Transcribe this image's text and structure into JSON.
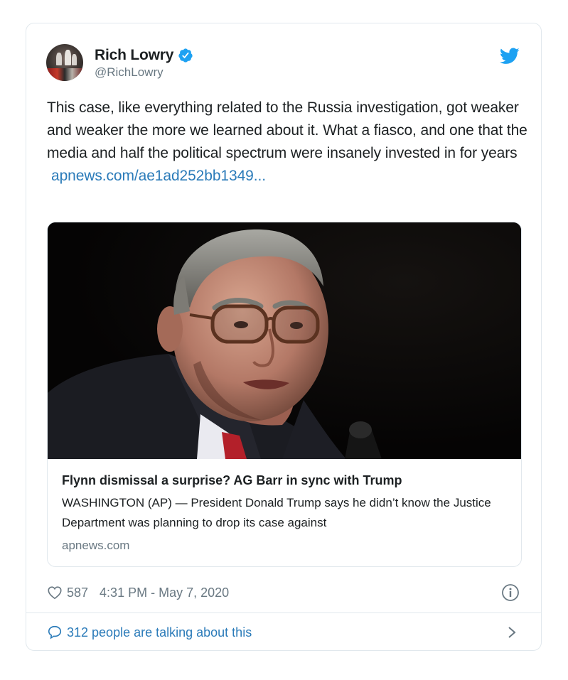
{
  "author": {
    "display_name": "Rich Lowry",
    "handle": "@RichLowry"
  },
  "tweet": {
    "text": "This case, like everything related to the Russia investigation, got weaker and weaker the more we learned about it. What a fiasco, and one that the media and half the political spectrum were insanely invested in for years",
    "link_text": "apnews.com/ae1ad252bb1349..."
  },
  "card": {
    "title": "Flynn dismissal a surprise? AG Barr in sync with Trump",
    "description": "WASHINGTON (AP) — President Donald Trump says he didn’t know the Justice Department was planning to drop its case against",
    "domain": "apnews.com"
  },
  "meta": {
    "likes": "587",
    "timestamp": "4:31 PM - May 7, 2020"
  },
  "footer": {
    "talking_label": "312 people are talking about this"
  },
  "colors": {
    "link": "#2b7bb9",
    "verified": "#1da1f2",
    "secondary": "#697882",
    "border": "#e1e8ed"
  },
  "icons": [
    "verified-badge-icon",
    "twitter-bird-icon",
    "heart-icon",
    "info-icon",
    "reply-bubble-icon",
    "chevron-right-icon"
  ]
}
